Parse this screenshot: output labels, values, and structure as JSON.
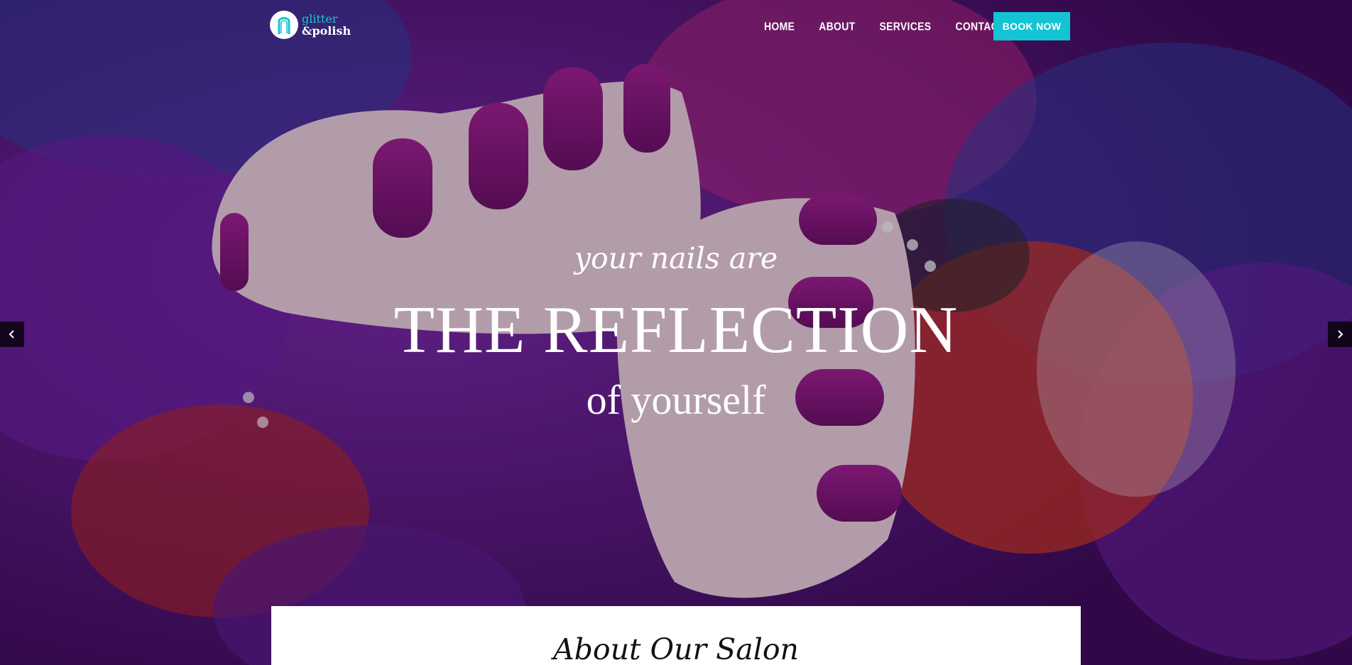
{
  "brand": {
    "line1": "glitter",
    "line2": "&polish",
    "icon": "nail-icon",
    "accent_color": "#12c4d4"
  },
  "nav": {
    "items": [
      {
        "label": "HOME"
      },
      {
        "label": "ABOUT"
      },
      {
        "label": "SERVICES"
      },
      {
        "label": "CONTACT"
      }
    ],
    "cta": "BOOK NOW"
  },
  "hero": {
    "line1": "your nails are",
    "line2": "THE REFLECTION",
    "line3": "of yourself",
    "prev_icon": "chevron-left-icon",
    "next_icon": "chevron-right-icon"
  },
  "about": {
    "title": "About Our Salon"
  }
}
